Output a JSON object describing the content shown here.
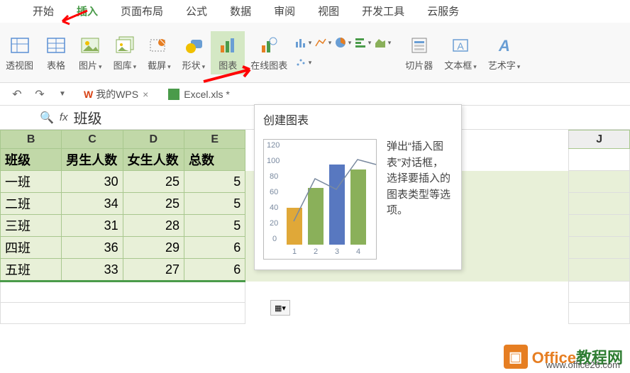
{
  "tabs": {
    "start": "开始",
    "insert": "插入",
    "page_layout": "页面布局",
    "formula": "公式",
    "data": "数据",
    "review": "审阅",
    "view": "视图",
    "dev_tools": "开发工具",
    "cloud": "云服务"
  },
  "ribbon": {
    "pivot_view": "透视图",
    "table": "表格",
    "picture": "图片",
    "gallery": "图库",
    "screenshot": "截屏",
    "shapes": "形状",
    "chart": "图表",
    "online_chart": "在线图表",
    "slicer": "切片器",
    "textbox": "文本框",
    "wordart": "艺术字"
  },
  "doc_tabs": {
    "wps": "我的WPS",
    "file": "Excel.xls *"
  },
  "formula_bar": {
    "fx": "fx",
    "value": "班级"
  },
  "columns": {
    "b": "B",
    "c": "C",
    "d": "D",
    "e": "E",
    "j": "J"
  },
  "headers": {
    "class": "班级",
    "boys": "男生人数",
    "girls": "女生人数",
    "total": "总数"
  },
  "rows": [
    {
      "class": "一班",
      "boys": "30",
      "girls": "25",
      "total": "5"
    },
    {
      "class": "二班",
      "boys": "34",
      "girls": "25",
      "total": "5"
    },
    {
      "class": "三班",
      "boys": "31",
      "girls": "28",
      "total": "5"
    },
    {
      "class": "四班",
      "boys": "36",
      "girls": "29",
      "total": "6"
    },
    {
      "class": "五班",
      "boys": "33",
      "girls": "27",
      "total": "6"
    }
  ],
  "tooltip": {
    "title": "创建图表",
    "text": "弹出“插入图表”对话框，选择要插入的图表类型等选项。"
  },
  "chart_data": {
    "type": "bar",
    "categories": [
      "1",
      "2",
      "3",
      "4"
    ],
    "values": [
      45,
      70,
      98,
      92
    ],
    "line_values": [
      30,
      82,
      70,
      105
    ],
    "ylim": [
      0,
      120
    ],
    "yticks": [
      0,
      20,
      40,
      60,
      80,
      100,
      120
    ]
  },
  "footer": {
    "brand": "Office",
    "brand2": "教程网",
    "url": "www.office26.com"
  }
}
